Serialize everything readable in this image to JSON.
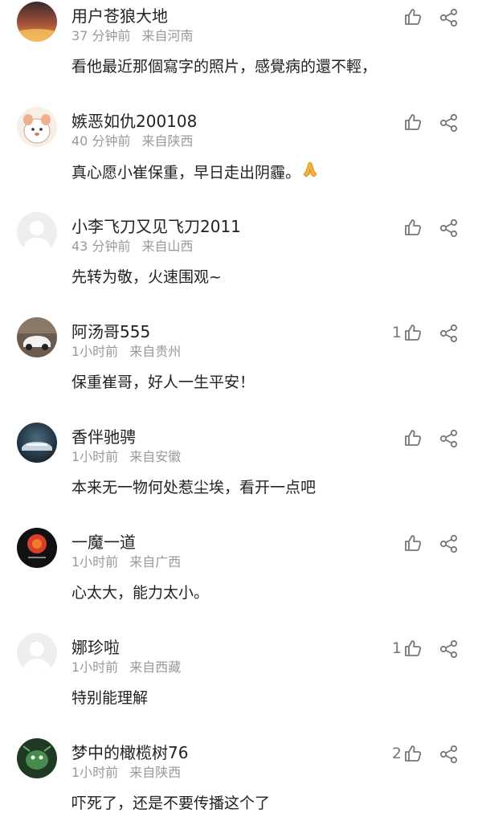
{
  "comments": [
    {
      "user": "用户苍狼大地",
      "time": "37 分钟前",
      "source": "来自河南",
      "text": "看他最近那個寫字的照片，感覺病的還不輕，",
      "likes": "",
      "avatar": "sunset-avatar"
    },
    {
      "user": "嫉恶如仇200108",
      "time": "40 分钟前",
      "source": "来自陕西",
      "text": "真心愿小崔保重，早日走出阴霾。",
      "likes": "",
      "avatar": "cartoon-avatar"
    },
    {
      "user": "小李飞刀又见飞刀2011",
      "time": "43 分钟前",
      "source": "来自山西",
      "text": "先转为敬，火速围观~",
      "likes": "",
      "avatar": "default-avatar"
    },
    {
      "user": "阿汤哥555",
      "time": "1小时前",
      "source": "来自贵州",
      "text": "保重崔哥，好人一生平安！",
      "likes": "1",
      "avatar": "car-showroom-avatar"
    },
    {
      "user": "香伴驰骋",
      "time": "1小时前",
      "source": "来自安徽",
      "text": "本来无一物何处惹尘埃，看开一点吧",
      "likes": "",
      "avatar": "car-avatar"
    },
    {
      "user": "一魔一道",
      "time": "1小时前",
      "source": "来自广西",
      "text": "心太大，能力太小。",
      "likes": "",
      "avatar": "red-logo-avatar"
    },
    {
      "user": "娜珍啦",
      "time": "1小时前",
      "source": "来自西藏",
      "text": "特别能理解",
      "likes": "1",
      "avatar": "default-avatar"
    },
    {
      "user": "梦中的橄榄树76",
      "time": "1小时前",
      "source": "来自陕西",
      "text": "吓死了，还是不要传播这个了",
      "likes": "2",
      "avatar": "green-avatar"
    }
  ],
  "icons": {
    "like": "thumbs-up-icon",
    "share": "share-icon",
    "emoji": "praying-hands-emoji"
  },
  "colors": {
    "text": "#222222",
    "meta": "#999999",
    "icon": "#777777",
    "background": "#ffffff"
  }
}
